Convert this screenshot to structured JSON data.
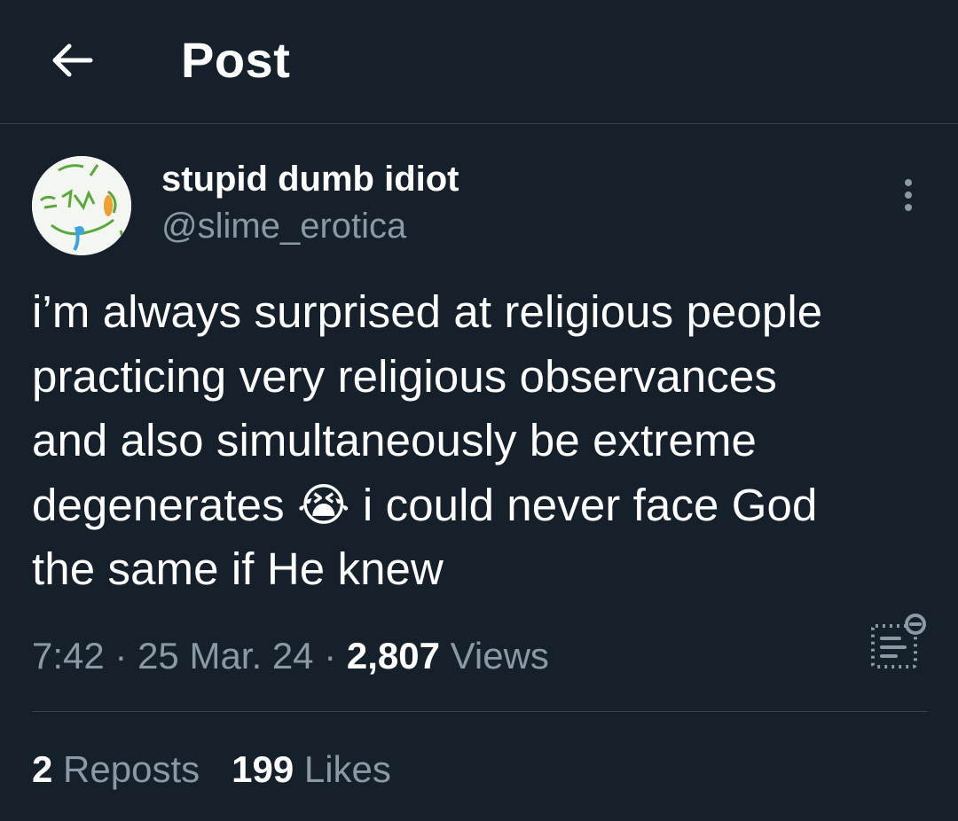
{
  "header": {
    "title": "Post",
    "back_icon": "arrow-left-icon"
  },
  "author": {
    "display_name": "stupid dumb idiot",
    "handle": "@slime_erotica",
    "avatar_icon": "sketch-face-avatar"
  },
  "post": {
    "text_before_emoji": "i’m always surprised at religious people\npracticing very religious observances\nand also simultaneously be extreme\ndegenerates ",
    "emoji": "😭",
    "emoji_name": "loudly-crying-face-emoji",
    "text_after_emoji": " i could never face God\nthe same if He knew"
  },
  "meta": {
    "time": "7:42",
    "separator": " · ",
    "date": "25 Mar. 24",
    "views_count": "2,807",
    "views_label": "Views",
    "analytics_icon": "post-analytics-icon"
  },
  "stats": {
    "reposts_count": "2",
    "reposts_label": "Reposts",
    "likes_count": "199",
    "likes_label": "Likes"
  },
  "colors": {
    "background": "#15202b",
    "primary_text": "#ffffff",
    "secondary_text": "#8b98a5",
    "divider": "#38444d"
  }
}
